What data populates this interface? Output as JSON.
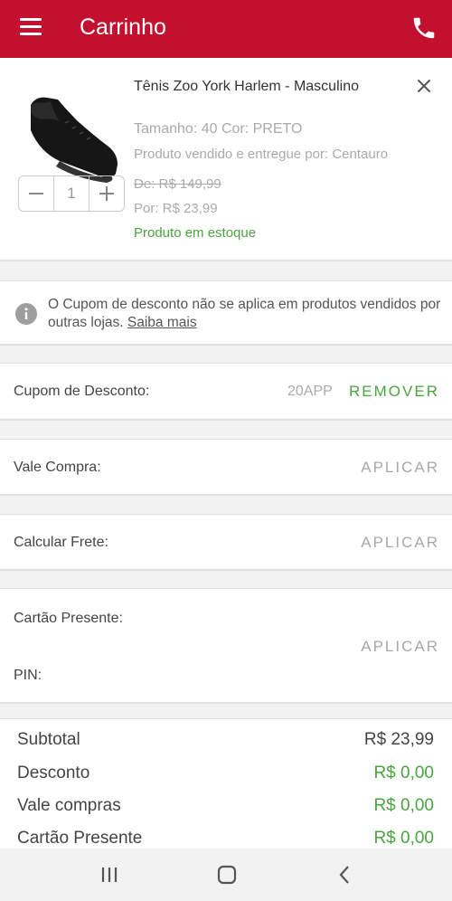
{
  "header": {
    "title": "Carrinho",
    "bg_color": "#c2102e",
    "menu_icon": "hamburger-menu-icon",
    "phone_icon": "phone-icon"
  },
  "product": {
    "name": "Tênis Zoo York Harlem - Masculino",
    "size_color": "Tamanho: 40  Cor: PRETO",
    "seller": "Produto vendido e entregue por: Centauro",
    "price_old": "De: R$  149,99",
    "price_new": "Por: R$  23,99",
    "stock": "Produto em estoque",
    "quantity": "1",
    "remove_icon": "close-icon"
  },
  "notice": {
    "text": "O Cupom de desconto não se aplica em produtos vendidos por outras lojas. ",
    "link": "Saiba mais"
  },
  "coupon": {
    "label": "Cupom de Desconto:",
    "code": "20APP",
    "action": "REMOVER"
  },
  "vale": {
    "label": "Vale Compra:",
    "action": "APLICAR"
  },
  "frete": {
    "label": "Calcular Frete:",
    "action": "APLICAR"
  },
  "gift": {
    "label": "Cartão Presente:",
    "pin_label": "PIN:",
    "action": "APLICAR"
  },
  "totals": [
    {
      "label": "Subtotal",
      "value": "R$  23,99"
    },
    {
      "label": "Desconto",
      "value": "R$ 0,00"
    },
    {
      "label": "Vale compras",
      "value": "R$ 0,00"
    },
    {
      "label": "Cartão Presente",
      "value": "R$ 0,00"
    }
  ],
  "colors": {
    "accent": "#c2102e",
    "green": "#4aa43f",
    "muted": "#a8a8a8"
  }
}
